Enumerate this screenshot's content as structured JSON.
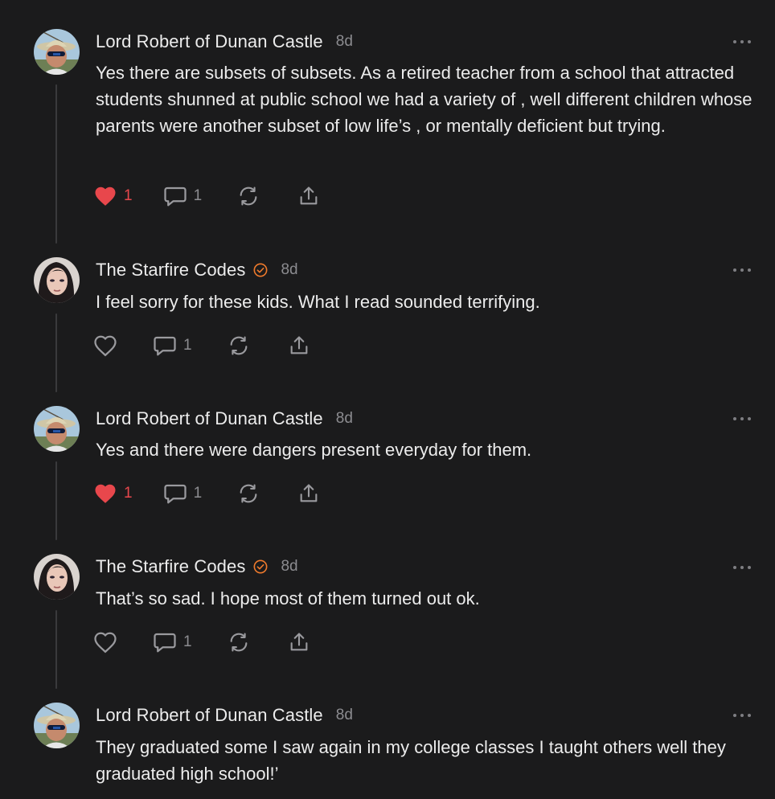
{
  "comments": [
    {
      "author": "Lord Robert of Dunan Castle",
      "time": "8d",
      "verified": false,
      "text": "Yes there are subsets of subsets. As a retired teacher from a school that attracted students shunned at public school we had a variety of , well different children whose parents were another subset of low life’s , or mentally deficient but trying.",
      "liked": true,
      "likes": "1",
      "replies": "1"
    },
    {
      "author": "The Starfire Codes",
      "time": "8d",
      "verified": true,
      "text": "I feel sorry for these kids. What I read sounded terrifying.",
      "liked": false,
      "likes": "",
      "replies": "1"
    },
    {
      "author": "Lord Robert of Dunan Castle",
      "time": "8d",
      "verified": false,
      "text": "Yes and there were dangers present everyday for them.",
      "liked": true,
      "likes": "1",
      "replies": "1"
    },
    {
      "author": "The Starfire Codes",
      "time": "8d",
      "verified": true,
      "text": "That’s so sad. I hope most of them turned out ok.",
      "liked": false,
      "likes": "",
      "replies": "1"
    },
    {
      "author": "Lord Robert of Dunan Castle",
      "time": "8d",
      "verified": false,
      "text": "They graduated some I saw again in my college classes I taught others well they graduated high school!’",
      "liked": false,
      "likes": "",
      "replies": ""
    }
  ],
  "colors": {
    "background": "#1b1b1c",
    "like_active": "#e8474c",
    "verified_badge": "#ef7a2c",
    "muted": "#8c8c90"
  },
  "icons": {
    "like": "heart-icon",
    "reply": "speech-bubble-icon",
    "restack": "restack-arrows-icon",
    "share": "share-upload-icon",
    "more": "more-dots-icon",
    "verified": "verified-check-icon"
  }
}
